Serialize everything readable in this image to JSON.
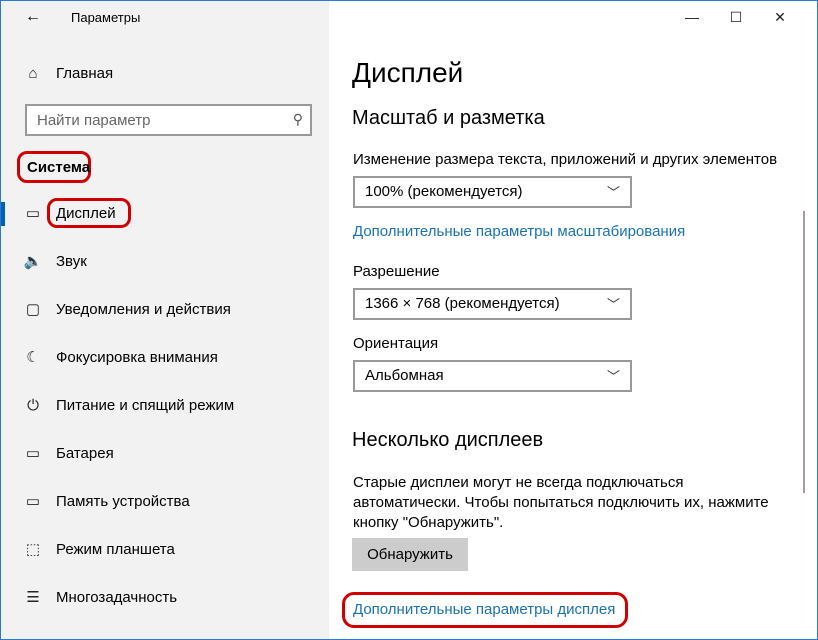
{
  "window": {
    "title": "Параметры",
    "controls": {
      "minimize": "—",
      "maximize": "☐",
      "close": "✕"
    }
  },
  "sidebar": {
    "back_icon": "←",
    "home": {
      "label": "Главная",
      "icon": "⌂"
    },
    "search": {
      "placeholder": "Найти параметр",
      "icon": "⚲"
    },
    "section": "Система",
    "items": [
      {
        "label": "Дисплей",
        "icon": "▭",
        "active": true
      },
      {
        "label": "Звук",
        "icon": "🔈"
      },
      {
        "label": "Уведомления и действия",
        "icon": "▢"
      },
      {
        "label": "Фокусировка внимания",
        "icon": "☾"
      },
      {
        "label": "Питание и спящий режим",
        "icon": "⏻"
      },
      {
        "label": "Батарея",
        "icon": "▭"
      },
      {
        "label": "Память устройства",
        "icon": "▭"
      },
      {
        "label": "Режим планшета",
        "icon": "⬚"
      },
      {
        "label": "Многозадачность",
        "icon": "☰"
      }
    ]
  },
  "main": {
    "page_title": "Дисплей",
    "scale_section": "Масштаб и разметка",
    "scale_label": "Изменение размера текста, приложений и других элементов",
    "scale_value": "100% (рекомендуется)",
    "scale_link": "Дополнительные параметры масштабирования",
    "resolution_label": "Разрешение",
    "resolution_value": "1366 × 768 (рекомендуется)",
    "orientation_label": "Ориентация",
    "orientation_value": "Альбомная",
    "multi_section": "Несколько дисплеев",
    "multi_text": "Старые дисплеи могут не всегда подключаться автоматически. Чтобы попытаться подключить их, нажмите кнопку \"Обнаружить\".",
    "detect_button": "Обнаружить",
    "advanced_link": "Дополнительные параметры дисплея",
    "chevron": "﹀"
  }
}
